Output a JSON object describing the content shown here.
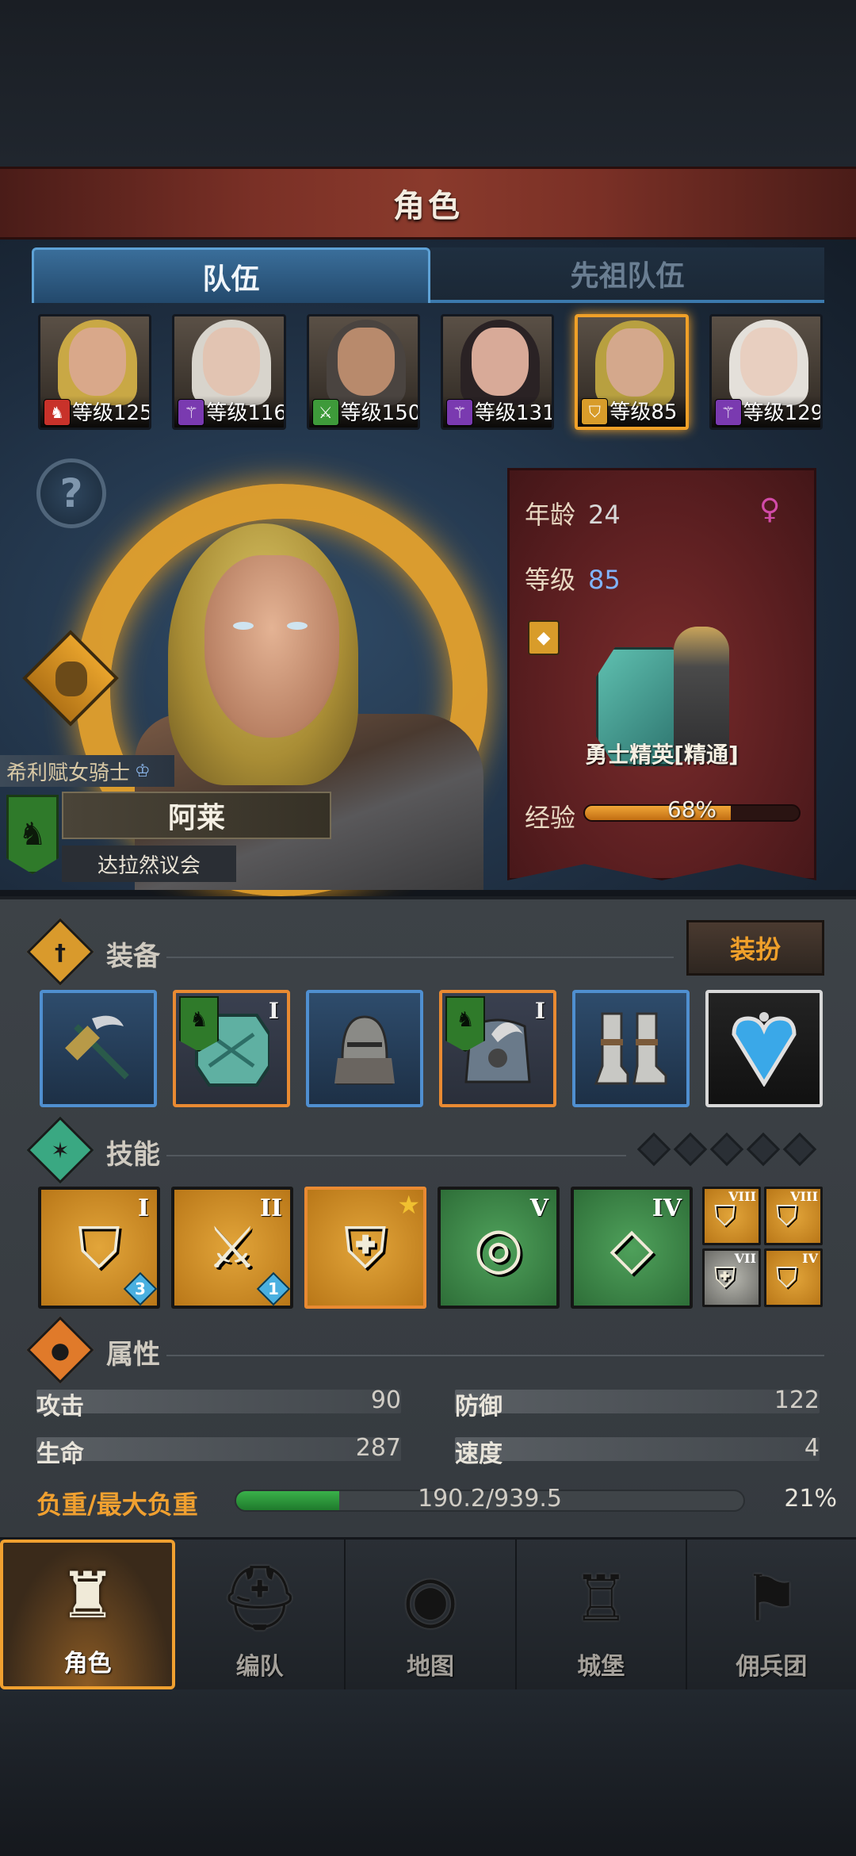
{
  "header": {
    "title": "角色"
  },
  "tabs": [
    {
      "label": "队伍",
      "active": true
    },
    {
      "label": "先祖队伍",
      "active": false
    }
  ],
  "party": [
    {
      "level_text": "等级125",
      "class_icon": "horse-icon",
      "badge_color": "#c8322a",
      "hair": "#c9a845",
      "skin": "#d9a88a"
    },
    {
      "level_text": "等级116",
      "class_icon": "staff-icon",
      "badge_color": "#7a3ab0",
      "hair": "#d8d4cc",
      "skin": "#e2c4b2"
    },
    {
      "level_text": "等级150",
      "class_icon": "swords-icon",
      "badge_color": "#3e9a3a",
      "hair": "#4a4440",
      "skin": "#b88a6c"
    },
    {
      "level_text": "等级131",
      "class_icon": "staff-icon",
      "badge_color": "#7a3ab0",
      "hair": "#2a2224",
      "skin": "#d8aa98"
    },
    {
      "level_text": "等级85",
      "class_icon": "shield-icon",
      "badge_color": "#d89c2a",
      "hair": "#b8a040",
      "skin": "#d4a88c",
      "selected": true
    },
    {
      "level_text": "等级129",
      "class_icon": "staff-icon",
      "badge_color": "#7a3ab0",
      "hair": "#e4e0da",
      "skin": "#e8cfc0"
    }
  ],
  "hero": {
    "title": "希利赋女骑士",
    "name": "阿莱",
    "house": "达拉然议会"
  },
  "stats_banner": {
    "age_label": "年龄",
    "age_value": "24",
    "level_label": "等级",
    "level_value": "85",
    "class_name": "勇士精英[精通]",
    "exp_label": "经验",
    "exp_text": "68%",
    "exp_fraction": 0.68
  },
  "equipment": {
    "title": "装备",
    "dress_button": "装扮",
    "slots": [
      {
        "item": "war-hammer-icon",
        "tier": ""
      },
      {
        "item": "tower-shield-icon",
        "tier": "I"
      },
      {
        "item": "helmet-icon",
        "tier": ""
      },
      {
        "item": "chest-armor-icon",
        "tier": "I"
      },
      {
        "item": "greaves-icon",
        "tier": ""
      },
      {
        "item": "heart-amulet-icon",
        "tier": ""
      }
    ]
  },
  "skills": {
    "title": "技能",
    "list": [
      {
        "icon": "shield-strike-icon",
        "tier": "I",
        "gem": "3"
      },
      {
        "icon": "sword-parry-icon",
        "tier": "II",
        "gem": "1"
      },
      {
        "icon": "shield-break-icon",
        "tier": ""
      },
      {
        "icon": "crystal-target-icon",
        "tier": "V"
      },
      {
        "icon": "crystal-icon",
        "tier": "IV"
      }
    ],
    "passives": [
      {
        "icon": "shield-burst-icon",
        "tier": "VIII"
      },
      {
        "icon": "shield-burst-icon",
        "tier": "VIII"
      },
      {
        "icon": "shield-ward-icon",
        "tier": "VII"
      },
      {
        "icon": "shield-icon",
        "tier": "IV"
      }
    ]
  },
  "attributes": {
    "title": "属性",
    "attack_label": "攻击",
    "attack_value": "90",
    "defense_label": "防御",
    "defense_value": "122",
    "health_label": "生命",
    "health_value": "287",
    "speed_label": "速度",
    "speed_value": "4",
    "load_label": "负重/最大负重",
    "load_text": "190.2/939.5",
    "load_pct": "21%",
    "load_fraction": 0.2025
  },
  "nav": [
    {
      "label": "角色",
      "icon": "knight-icon",
      "active": true
    },
    {
      "label": "编队",
      "icon": "helmet-icon",
      "active": false
    },
    {
      "label": "地图",
      "icon": "compass-map-icon",
      "active": false
    },
    {
      "label": "城堡",
      "icon": "castle-icon",
      "active": false
    },
    {
      "label": "佣兵团",
      "icon": "banner-fist-icon",
      "active": false
    }
  ]
}
